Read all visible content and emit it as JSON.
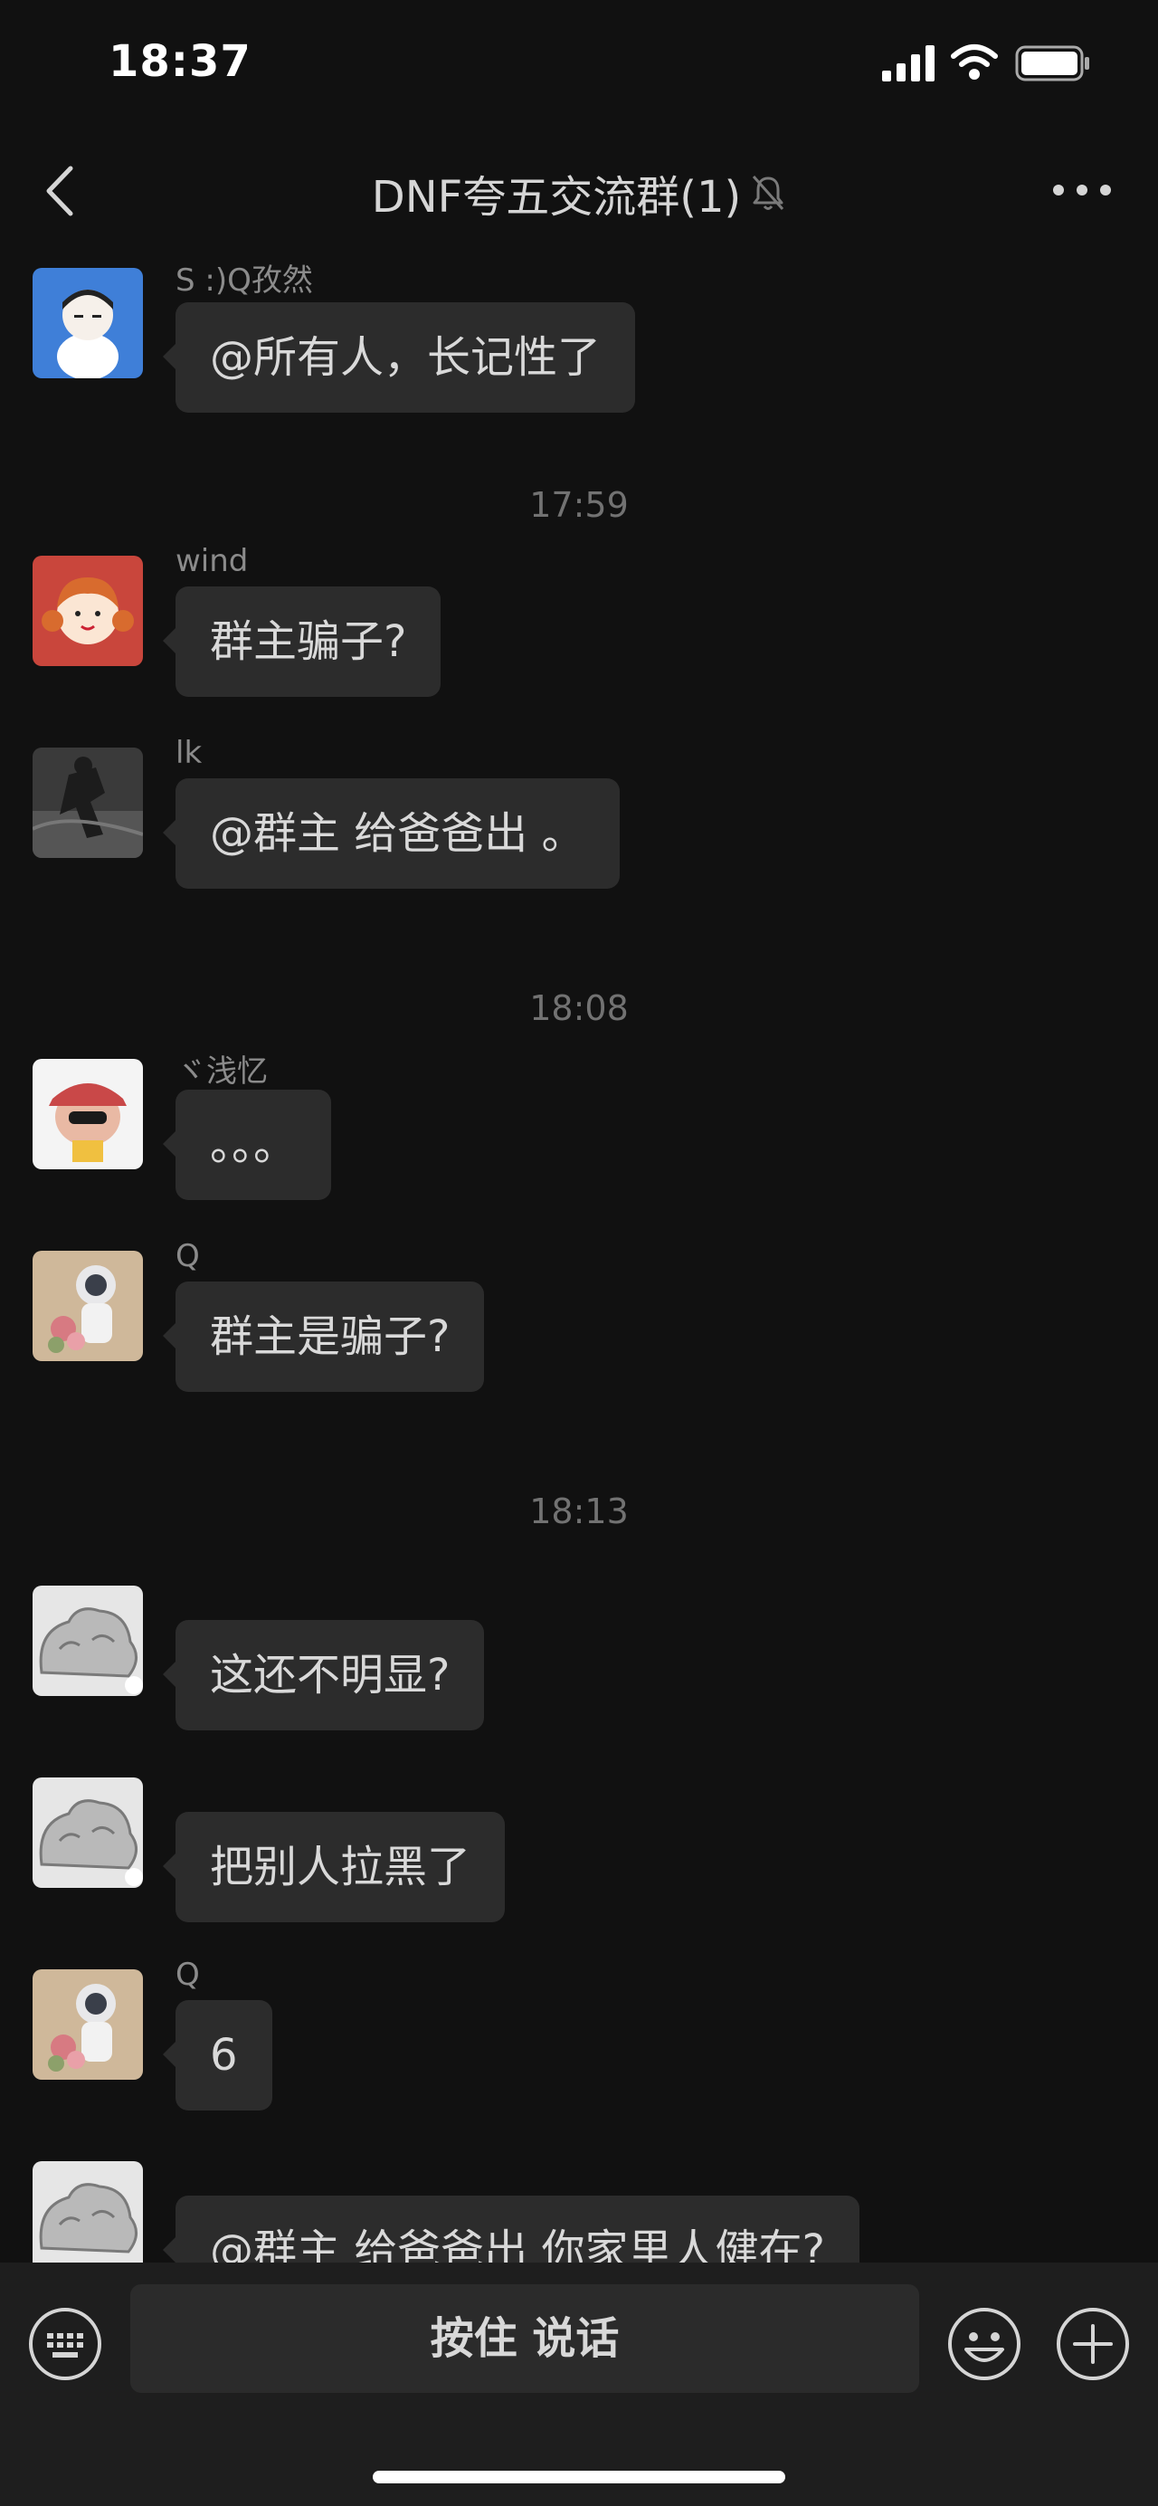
{
  "status_bar": {
    "time": "18:37"
  },
  "nav": {
    "title": "DNF夸五交流群(1)"
  },
  "chat": {
    "messages": [
      {
        "sender": "S :)Q孜然",
        "text": "@所有人，长记性了"
      },
      {
        "sender": "wind",
        "text": "群主骗子?"
      },
      {
        "sender": "lk",
        "text": "@群主 给爸爸出 。"
      },
      {
        "sender": "ヾ浅忆",
        "text": "。。。"
      },
      {
        "sender": "Q",
        "text": "群主是骗子?"
      },
      {
        "sender": "",
        "text": "这还不明显?"
      },
      {
        "sender": "",
        "text": "把别人拉黑了"
      },
      {
        "sender": "Q",
        "text": "6"
      },
      {
        "sender": "",
        "text": "@群主 给爸爸出 你家里人健在?"
      }
    ],
    "timestamps": [
      "17:59",
      "18:08",
      "18:13"
    ]
  },
  "input_bar": {
    "hold_to_talk_label": "按住 说话"
  },
  "colors": {
    "background": "#111111",
    "bubble": "#2c2c2c",
    "input_bar": "#1e1e1e"
  }
}
